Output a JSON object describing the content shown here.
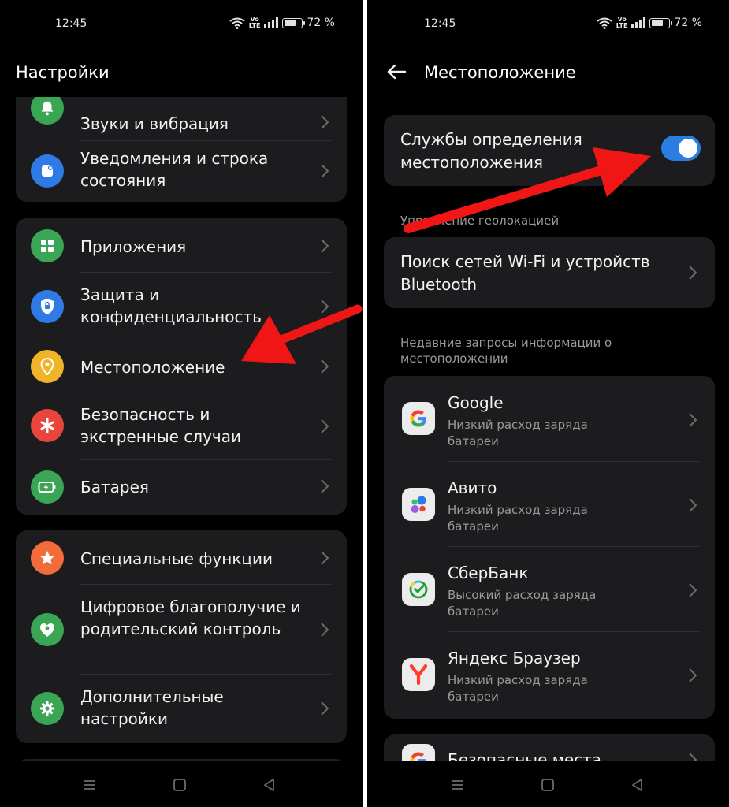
{
  "status": {
    "time": "12:45",
    "battery_text": "72 %",
    "battery_level": 0.72,
    "volte_top": "Vo",
    "volte_bottom": "LTE"
  },
  "settings": {
    "title": "Настройки",
    "group1": [
      {
        "label": "Звуки и вибрация",
        "icon": "bell-icon",
        "color": "#3aa655"
      },
      {
        "label": "Уведомления и строка состояния",
        "icon": "notification-icon",
        "color": "#2f7be5"
      }
    ],
    "group2": [
      {
        "label": "Приложения",
        "icon": "apps-grid-icon",
        "color": "#3aa655"
      },
      {
        "label": "Защита и конфиденциальность",
        "icon": "shield-icon",
        "color": "#2f7be5"
      },
      {
        "label": "Местоположение",
        "icon": "location-pin-icon",
        "color": "#f0b429"
      },
      {
        "label": "Безопасность и экстренные случаи",
        "icon": "asterisk-icon",
        "color": "#e8453c"
      },
      {
        "label": "Батарея",
        "icon": "battery-icon",
        "color": "#3aa655"
      }
    ],
    "group3": [
      {
        "label": "Специальные функции",
        "icon": "star-icon",
        "color": "#f26b3a"
      },
      {
        "label": "Цифровое благополучие и родительский контроль",
        "icon": "wellbeing-icon",
        "color": "#3aa655"
      },
      {
        "label": "Дополнительные настройки",
        "icon": "gear-icon",
        "color": "#3aa655"
      }
    ]
  },
  "location": {
    "title": "Местоположение",
    "services_label": "Службы определения местоположения",
    "services_enabled": true,
    "geo_header": "Управление геолокацией",
    "wifi_scan_label": "Поиск сетей Wi-Fi и устройств Bluetooth",
    "recent_header": "Недавние запросы информации о местоположении",
    "apps": [
      {
        "name": "Google",
        "usage": "Низкий расход заряда батареи",
        "icon": "google-icon"
      },
      {
        "name": "Авито",
        "usage": "Низкий расход заряда батареи",
        "icon": "avito-icon"
      },
      {
        "name": "СберБанк",
        "usage": "Высокий расход заряда батареи",
        "icon": "sberbank-icon"
      },
      {
        "name": "Яндекс Браузер",
        "usage": "Низкий расход заряда батареи",
        "icon": "yandex-browser-icon"
      }
    ],
    "next_label": "Безопасные места"
  },
  "colors": {
    "accent": "#2a7de1",
    "arrow": "#f01616",
    "card": "#1c1c1e",
    "background": "#000000"
  }
}
